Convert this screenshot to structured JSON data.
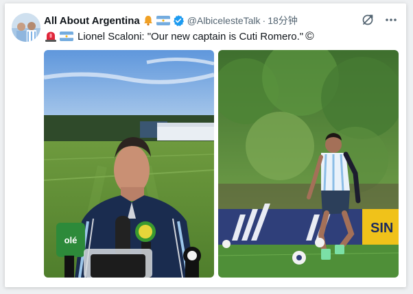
{
  "post": {
    "account_name": "All About Argentina",
    "handle": "@AlbicelesteTalk",
    "separator": "·",
    "time": "18分钟",
    "text": "Lionel Scaloni: \"Our new captain is Cuti Romero.\"",
    "copyright_symbol": "©"
  },
  "media": {
    "left_photo_text": "olé",
    "right_photo_text": "SIN"
  },
  "icons": {
    "bell": "bell-icon",
    "flag": "argentina-flag-icon",
    "verified": "verified-badge-icon",
    "grok": "grok-icon",
    "more": "more-icon",
    "siren": "siren-icon"
  },
  "colors": {
    "verified": "#1d9bf0",
    "text": "#0f1419",
    "muted": "#536471"
  }
}
